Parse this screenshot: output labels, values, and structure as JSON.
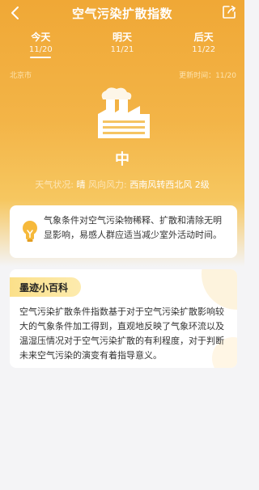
{
  "header": {
    "title": "空气污染扩散指数",
    "back_icon": "chevron-left-icon",
    "share_icon": "share-icon"
  },
  "tabs": [
    {
      "label": "今天",
      "date": "11/20",
      "active": true
    },
    {
      "label": "明天",
      "date": "11/21",
      "active": false
    },
    {
      "label": "后天",
      "date": "11/22",
      "active": false
    }
  ],
  "meta": {
    "city": "北京市",
    "update_time": "更新时间：11/20"
  },
  "index": {
    "level": "中",
    "weather_label": "天气状况:",
    "weather_value": "晴",
    "wind_label": "风向风力:",
    "wind_value": "西南风转西北风 2级"
  },
  "advice": {
    "text": "气象条件对空气污染物稀释、扩散和清除无明显影响，易感人群应适当减少室外活动时间。"
  },
  "encyclopedia": {
    "tag": "墨迹小百科",
    "text": "空气污染扩散条件指数基于对于空气污染扩散影响较大的气象条件加工得到，直观地反映了气象环流以及温湿压情况对于空气污染扩散的有利程度，对于判断未来空气污染的演变有着指导意义。"
  },
  "colors": {
    "hero_top": "#f0a836",
    "hero_bottom": "#f6c760",
    "accent_yellow": "#fbe08a"
  }
}
